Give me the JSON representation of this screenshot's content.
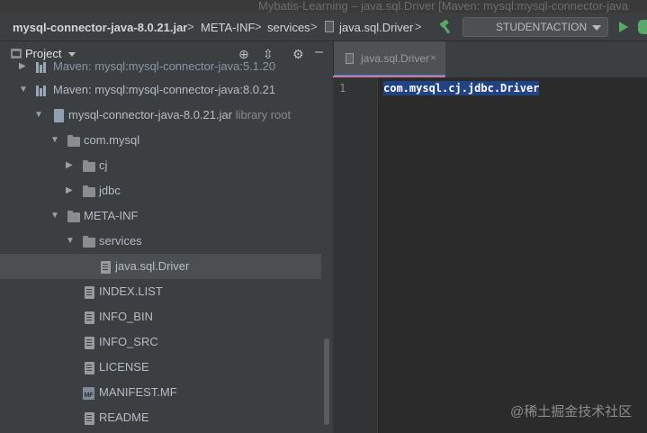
{
  "window": {
    "title": "Mybatis-Learning – java.sql.Driver [Maven: mysql:mysql-connector-java"
  },
  "breadcrumb": [
    {
      "label": "mysql-connector-java-8.0.21.jar"
    },
    {
      "label": "META-INF"
    },
    {
      "label": "services"
    },
    {
      "label": "java.sql.Driver"
    }
  ],
  "breadcrumb_sep": ">",
  "run_config": {
    "selected": "STUDENTACTION"
  },
  "project_panel": {
    "title": "Project",
    "items": [
      {
        "label": "Maven: mysql:mysql-connector-java:5.1.20",
        "icon": "library-icon"
      },
      {
        "label": "Maven: mysql:mysql-connector-java:8.0.21",
        "icon": "library-icon"
      },
      {
        "label": "mysql-connector-java-8.0.21.jar",
        "suffix": "library root",
        "icon": "jar-icon"
      },
      {
        "label": "com.mysql",
        "icon": "package-icon"
      },
      {
        "label": "cj",
        "icon": "package-icon"
      },
      {
        "label": "jdbc",
        "icon": "package-icon"
      },
      {
        "label": "META-INF",
        "icon": "folder-icon"
      },
      {
        "label": "services",
        "icon": "folder-icon"
      },
      {
        "label": "java.sql.Driver",
        "icon": "text-file-icon"
      },
      {
        "label": "INDEX.LIST",
        "icon": "text-file-icon"
      },
      {
        "label": "INFO_BIN",
        "icon": "text-file-icon"
      },
      {
        "label": "INFO_SRC",
        "icon": "text-file-icon"
      },
      {
        "label": "LICENSE",
        "icon": "text-file-icon"
      },
      {
        "label": "MANIFEST.MF",
        "icon": "manifest-file-icon",
        "badge": "MF"
      },
      {
        "label": "README",
        "icon": "text-file-icon"
      }
    ]
  },
  "editor": {
    "tab": {
      "label": "java.sql.Driver",
      "close": "×"
    },
    "lines": [
      {
        "number": "1",
        "text": "com.mysql.cj.jdbc.Driver"
      }
    ]
  },
  "watermark": "@稀土掘金技术社区",
  "colors": {
    "selection": "#214283",
    "tab_accent": "#c57aa6",
    "run_green": "#59a869",
    "panel_bg": "#3c3f41",
    "editor_bg": "#2b2b2b"
  }
}
